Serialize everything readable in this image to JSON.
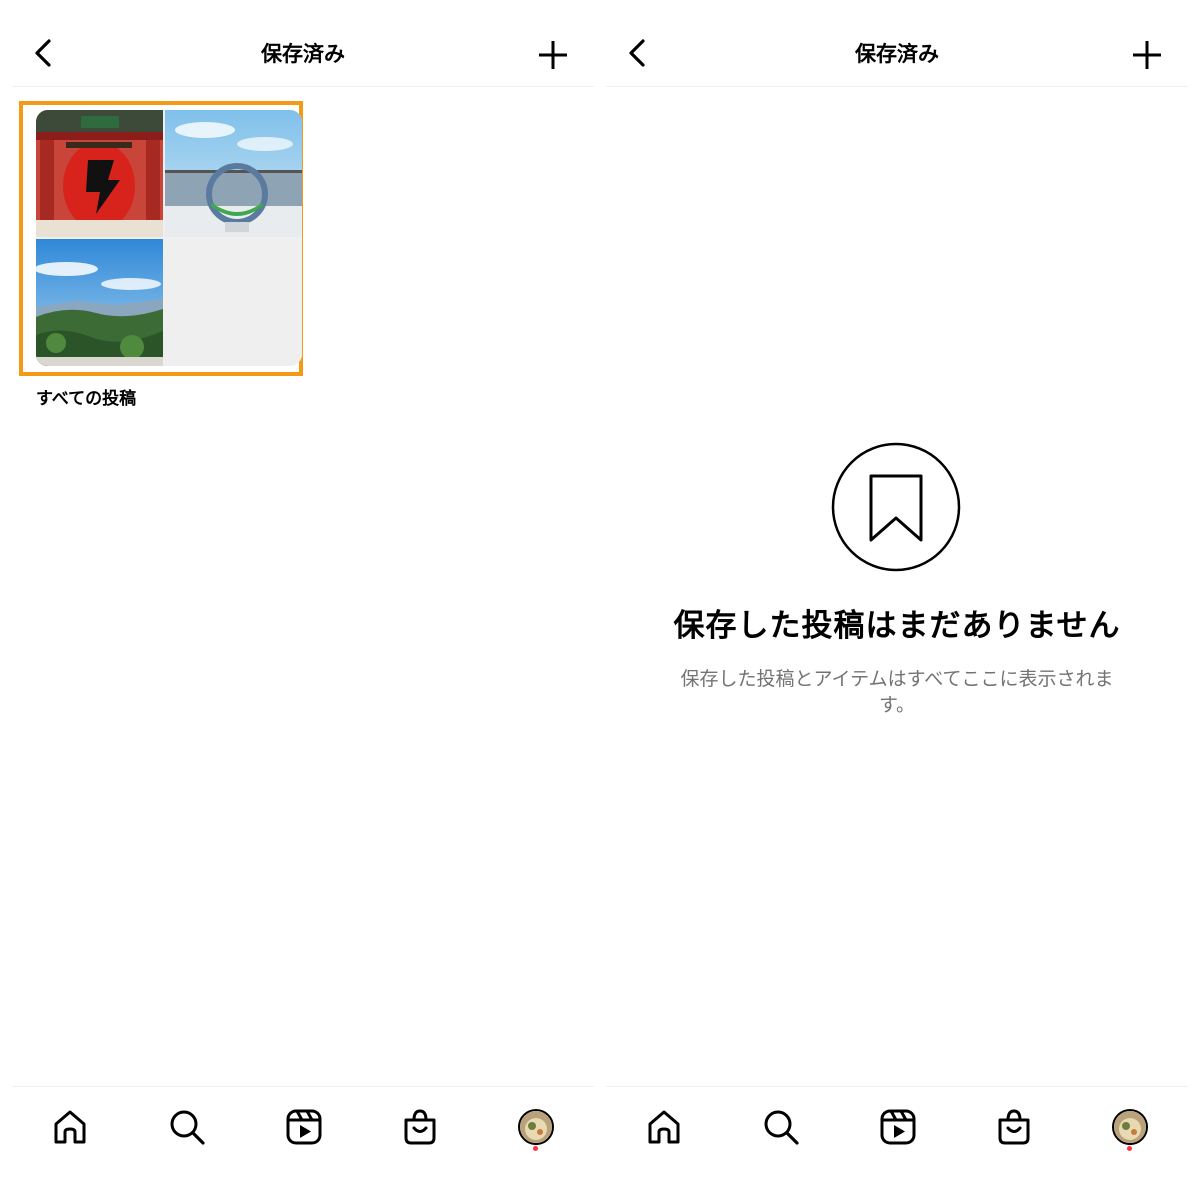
{
  "left": {
    "header": {
      "title": "保存済み",
      "back_icon": "chevron-left-icon",
      "add_icon": "plus-icon"
    },
    "collection": {
      "label": "すべての投稿",
      "highlight_color": "#f59a16"
    },
    "bottom_nav": [
      "home-icon",
      "search-icon",
      "reels-icon",
      "shop-icon",
      "profile-avatar"
    ]
  },
  "right": {
    "header": {
      "title": "保存済み",
      "back_icon": "chevron-left-icon",
      "add_icon": "plus-icon"
    },
    "empty_state": {
      "icon": "bookmark-icon",
      "title": "保存した投稿はまだありません",
      "description": "保存した投稿とアイテムはすべてここに表示されます。"
    },
    "bottom_nav": [
      "home-icon",
      "search-icon",
      "reels-icon",
      "shop-icon",
      "profile-avatar"
    ]
  },
  "colors": {
    "accent_highlight": "#f59a16",
    "notification_dot": "#ff3040",
    "secondary_text": "#737373",
    "divider": "#efefef"
  }
}
